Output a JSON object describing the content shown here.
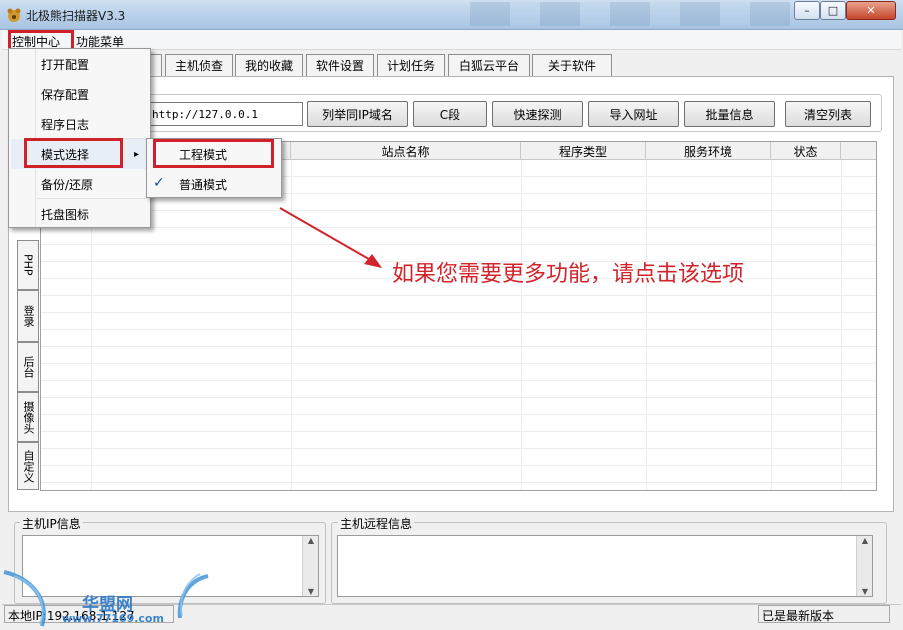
{
  "window": {
    "title": "北极熊扫描器V3.3",
    "controls": [
      "–",
      "□",
      "✕"
    ]
  },
  "menubar": {
    "control_center": "控制中心",
    "function_menu": "功能菜单"
  },
  "tabs": [
    "主机侦查",
    "我的收藏",
    "软件设置",
    "计划任务",
    "白狐云平台",
    "关于软件"
  ],
  "toolbar": {
    "url_value": "http://127.0.0.1",
    "buttons": [
      "列举同IP域名",
      "C段",
      "快速探测",
      "导入网址",
      "批量信息",
      "清空列表"
    ]
  },
  "grid": {
    "columns": [
      "站点名称",
      "程序类型",
      "服务环境",
      "状态"
    ]
  },
  "side_tabs": [
    "PHP",
    "登录",
    "后台",
    "摄像头",
    "自定义"
  ],
  "control_menu": {
    "items": [
      "打开配置",
      "保存配置",
      "程序日志",
      "模式选择",
      "备份/还原",
      "托盘图标"
    ],
    "submenu_arrow": "▸"
  },
  "mode_submenu": {
    "items": [
      "工程模式",
      "普通模式"
    ],
    "checked": "✓"
  },
  "annotation": {
    "text": "如果您需要更多功能，请点击该选项",
    "color": "#d3232a"
  },
  "panels": {
    "host_ip": "主机IP信息",
    "host_remote": "主机远程信息"
  },
  "statusbar": {
    "local_ip": "本地IP:192.168.1.127",
    "version_status": "已是最新版本"
  },
  "watermark": {
    "brand": "华盟网",
    "url": "www.77169.com"
  },
  "scroll": {
    "up": "▲",
    "down": "▼"
  }
}
